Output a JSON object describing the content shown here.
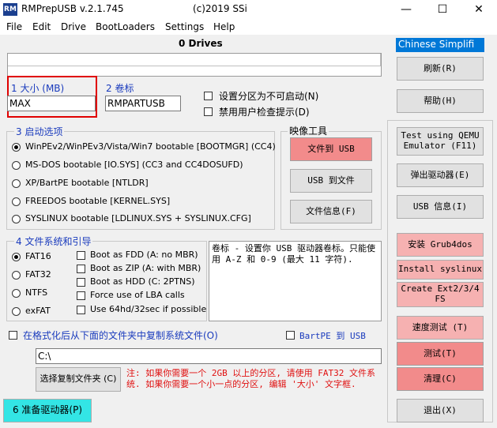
{
  "window": {
    "title": "RMPrepUSB v.2.1.745",
    "copyright": "(c)2019 SSi",
    "icon_text": "RM",
    "minimize": "—",
    "maximize": "☐",
    "close": "✕"
  },
  "menu": [
    "File",
    "Edit",
    "Drive",
    "BootLoaders",
    "Settings",
    "Help"
  ],
  "drives_header": "0 Drives",
  "language_select": "Chinese Simplifi",
  "size": {
    "label": "1 大小 (MB)",
    "value": "MAX"
  },
  "volume": {
    "label": "2 卷标",
    "value": "RMPARTUSB"
  },
  "options": {
    "non_bootable": "设置分区为不可启动(N)",
    "disable_user_prompt": "禁用用户检查提示(D)"
  },
  "boot_options": {
    "label": "3 启动选项",
    "items": [
      "WinPEv2/WinPEv3/Vista/Win7 bootable [BOOTMGR] (CC4)",
      "MS-DOS bootable [IO.SYS]     (CC3 and CC4DOSUFD)",
      "XP/BartPE bootable [NTLDR]",
      "FREEDOS bootable [KERNEL.SYS]",
      "SYSLINUX bootable [LDLINUX.SYS + SYSLINUX.CFG]"
    ]
  },
  "image_tools": {
    "label": "映像工具",
    "file_to_usb": "文件到 USB",
    "usb_to_file": "USB 到文件",
    "file_info": "文件信息(F)"
  },
  "filesystem": {
    "label": "4 文件系统和引导",
    "types": [
      "FAT16",
      "FAT32",
      "NTFS",
      "exFAT"
    ],
    "boot_opts": [
      "Boot as FDD (A: no MBR)",
      "Boot as ZIP (A: with MBR)",
      "Boot as HDD (C: 2PTNS)",
      "Force use of LBA calls",
      "Use 64hd/32sec if possible"
    ]
  },
  "help_text": "卷标 - 设置你 USB 驱动器卷标。只能使用 A-Z 和 0-9 (最大 11 字符).",
  "copy_files": {
    "label": "在格式化后从下面的文件夹中复制系统文件(O)",
    "path": "C:\\",
    "choose_button": "选择复制文件夹 (C)",
    "bartpe": "BartPE 到 USB"
  },
  "note": "注: 如果你需要一个 2GB 以上的分区, 请使用 FAT32 文件系统. 如果你需要一个小一点的分区, 编辑 '大小' 文字框.",
  "prepare_button": "6 准备驱动器(P)",
  "right_buttons": {
    "refresh": "刷新(R)",
    "help": "帮助(H)",
    "test_qemu": "Test using QEMU Emulator (F11)",
    "eject": "弹出驱动器(E)",
    "usb_info": "USB 信息(I)",
    "install_grub4dos": "安装 Grub4dos",
    "install_syslinux": "Install syslinux",
    "create_ext": "Create Ext2/3/4 FS",
    "speed_test": "速度测试 (T)",
    "test": "测试(T)",
    "clean": "清理(C)",
    "exit": "退出(X)"
  },
  "colors": {
    "red_button": "#f28b8b",
    "pink_button": "#f6b1b1",
    "cyan_button": "#33e5e5",
    "highlight_border": "#e00000",
    "note_red": "#e01010",
    "select_blue": "#0078d7"
  }
}
